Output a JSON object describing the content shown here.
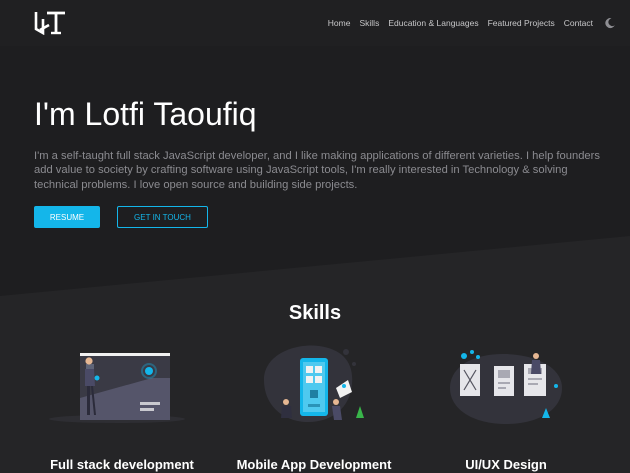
{
  "navbar": {
    "logo_icon": "lt-monogram-logo",
    "links": [
      "Home",
      "Skills",
      "Education & Languages",
      "Featured Projects",
      "Contact"
    ],
    "theme_toggle_icon": "moon-icon"
  },
  "hero": {
    "title": "I'm Lotfi Taoufiq",
    "description": "I'm a self-taught full stack JavaScript developer, and I like making applications of different varieties. I help founders add value to society by crafting software using JavaScript tools, I'm really interested in Technology & solving technical problems. I love open source and building side projects.",
    "resume_label": "RESUME",
    "contact_label": "GET IN TOUCH"
  },
  "skills": {
    "title": "Skills",
    "items": [
      {
        "label": "Full stack development",
        "icon": "full-stack-illustration"
      },
      {
        "label": "Mobile App Development",
        "icon": "mobile-app-illustration"
      },
      {
        "label": "UI/UX Design",
        "icon": "ui-ux-illustration"
      }
    ]
  },
  "colors": {
    "accent": "#14b6ea",
    "background": "#252527",
    "hero_background": "#1e1e20",
    "navbar_background": "#202022"
  }
}
